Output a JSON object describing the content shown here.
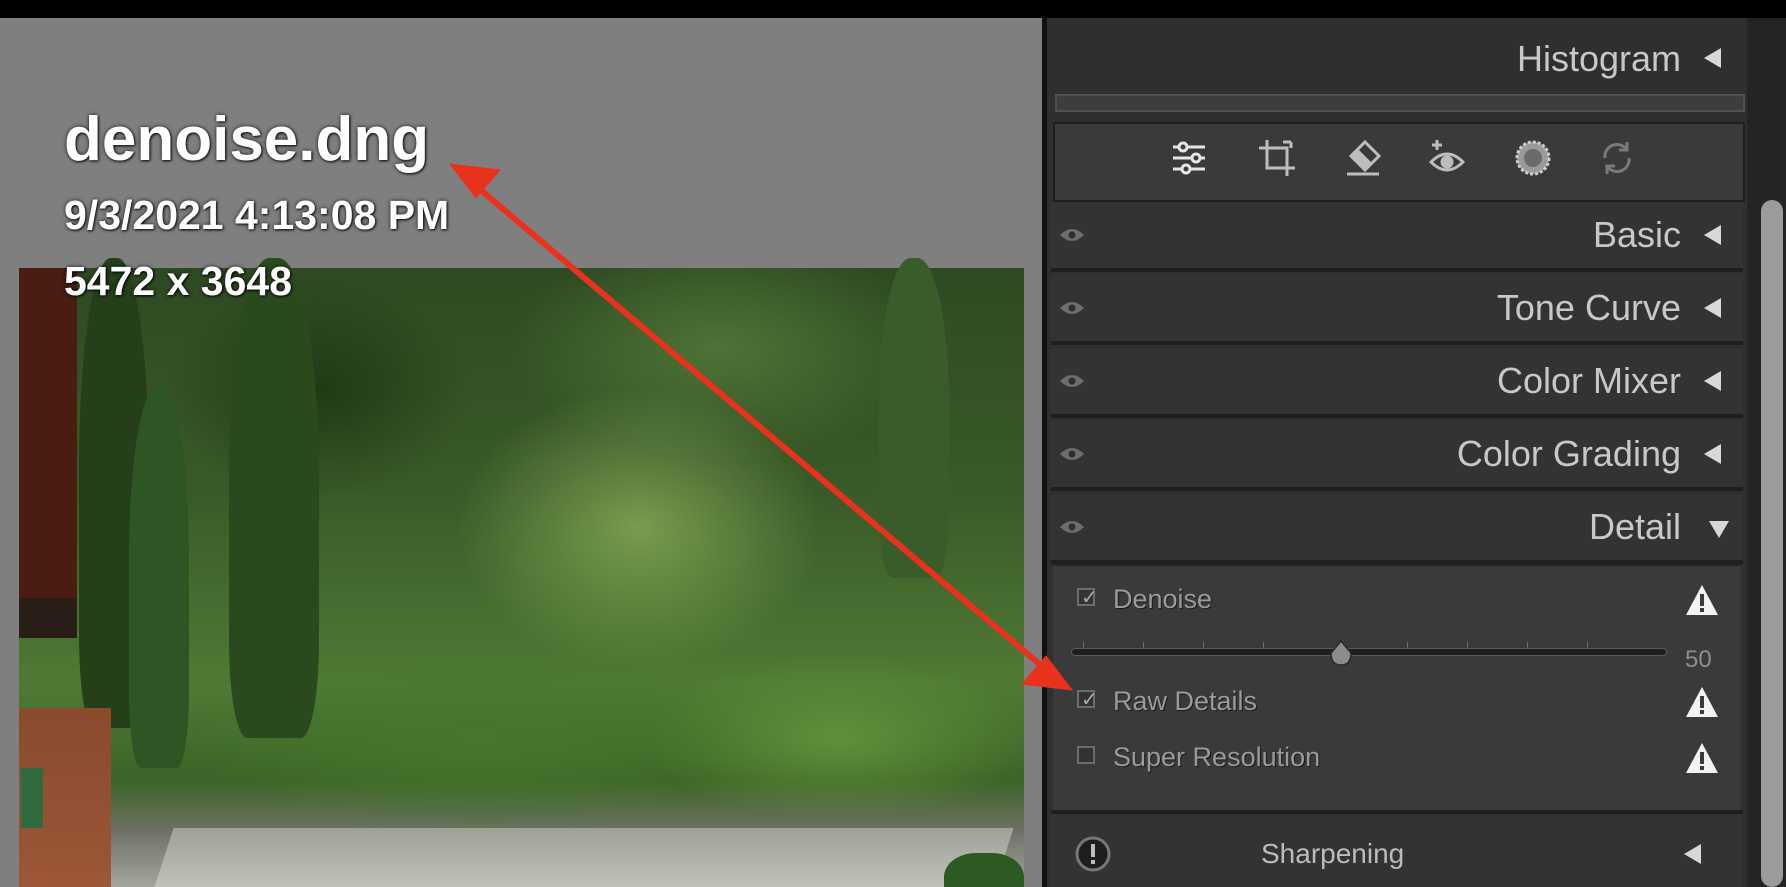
{
  "image": {
    "file_name": "denoise.dng",
    "capture_date": "9/3/2021 4:13:08 PM",
    "dimensions": "5472 x 3648"
  },
  "panel": {
    "histogram_label": "Histogram",
    "toolbar_tools": [
      "edit-sliders-icon",
      "crop-icon",
      "eraser-icon",
      "red-eye-icon",
      "masking-icon",
      "presets-sync-icon"
    ],
    "sections": [
      {
        "title": "Basic",
        "expanded": false
      },
      {
        "title": "Tone Curve",
        "expanded": false
      },
      {
        "title": "Color Mixer",
        "expanded": false
      },
      {
        "title": "Color Grading",
        "expanded": false
      },
      {
        "title": "Detail",
        "expanded": true
      }
    ],
    "detail": {
      "denoise_label": "Denoise",
      "denoise_checked": true,
      "denoise_value": "50",
      "raw_details_label": "Raw Details",
      "raw_details_checked": true,
      "super_resolution_label": "Super Resolution",
      "super_resolution_checked": false
    },
    "sharpening_label": "Sharpening"
  },
  "colors": {
    "panel_bg": "#2f2f2f",
    "annotation_arrow": "#e8321e",
    "text": "#c8c8c8"
  }
}
